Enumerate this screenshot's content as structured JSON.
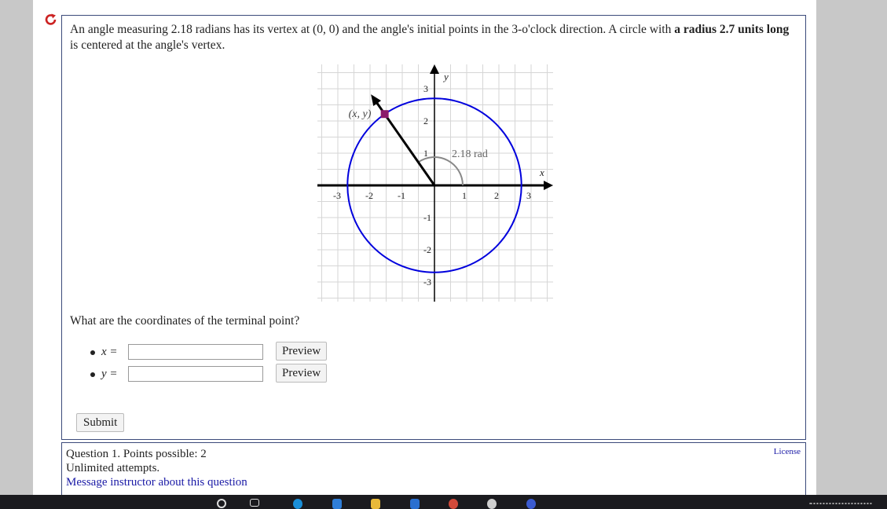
{
  "question": {
    "prompt_part1": "An angle measuring 2.18 radians has its vertex at (0, 0) and the angle's initial points in the 3-o'clock direction. A circle with ",
    "prompt_bold1": "a radius 2.7 units long",
    "prompt_part2": " is centered at the angle's vertex.",
    "ask": "What are the coordinates of the terminal point?",
    "x_label": "x =",
    "y_label": "y =",
    "x_value": "",
    "y_value": "",
    "preview_label": "Preview",
    "submit_label": "Submit"
  },
  "info": {
    "question_line": "Question 1. Points possible: 2",
    "attempts": "Unlimited attempts.",
    "message_link": "Message instructor about this question",
    "license": "License"
  },
  "chart_data": {
    "type": "scatter",
    "title": "",
    "xlabel": "x",
    "ylabel": "y",
    "xlim": [
      -3.6,
      3.6
    ],
    "ylim": [
      -3.6,
      3.6
    ],
    "grid": true,
    "x_tick_labels": [
      "-3",
      "-2",
      "-1",
      "1",
      "2",
      "3"
    ],
    "y_tick_labels": [
      "3",
      "2",
      "1",
      "-1",
      "-2",
      "-3"
    ],
    "angle_radians": 2.18,
    "radius": 2.7,
    "angle_label": "2.18 rad",
    "point_label": "(x, y)",
    "colors": {
      "circle": "#0000dd",
      "point": "#8b1a6b",
      "arc": "#888888",
      "grid": "#d6d6d6",
      "axes": "#000000"
    }
  },
  "colors": {
    "reload_icon": "#cc2222",
    "box_border": "#3b4a7a",
    "link": "#1a1aa6"
  }
}
